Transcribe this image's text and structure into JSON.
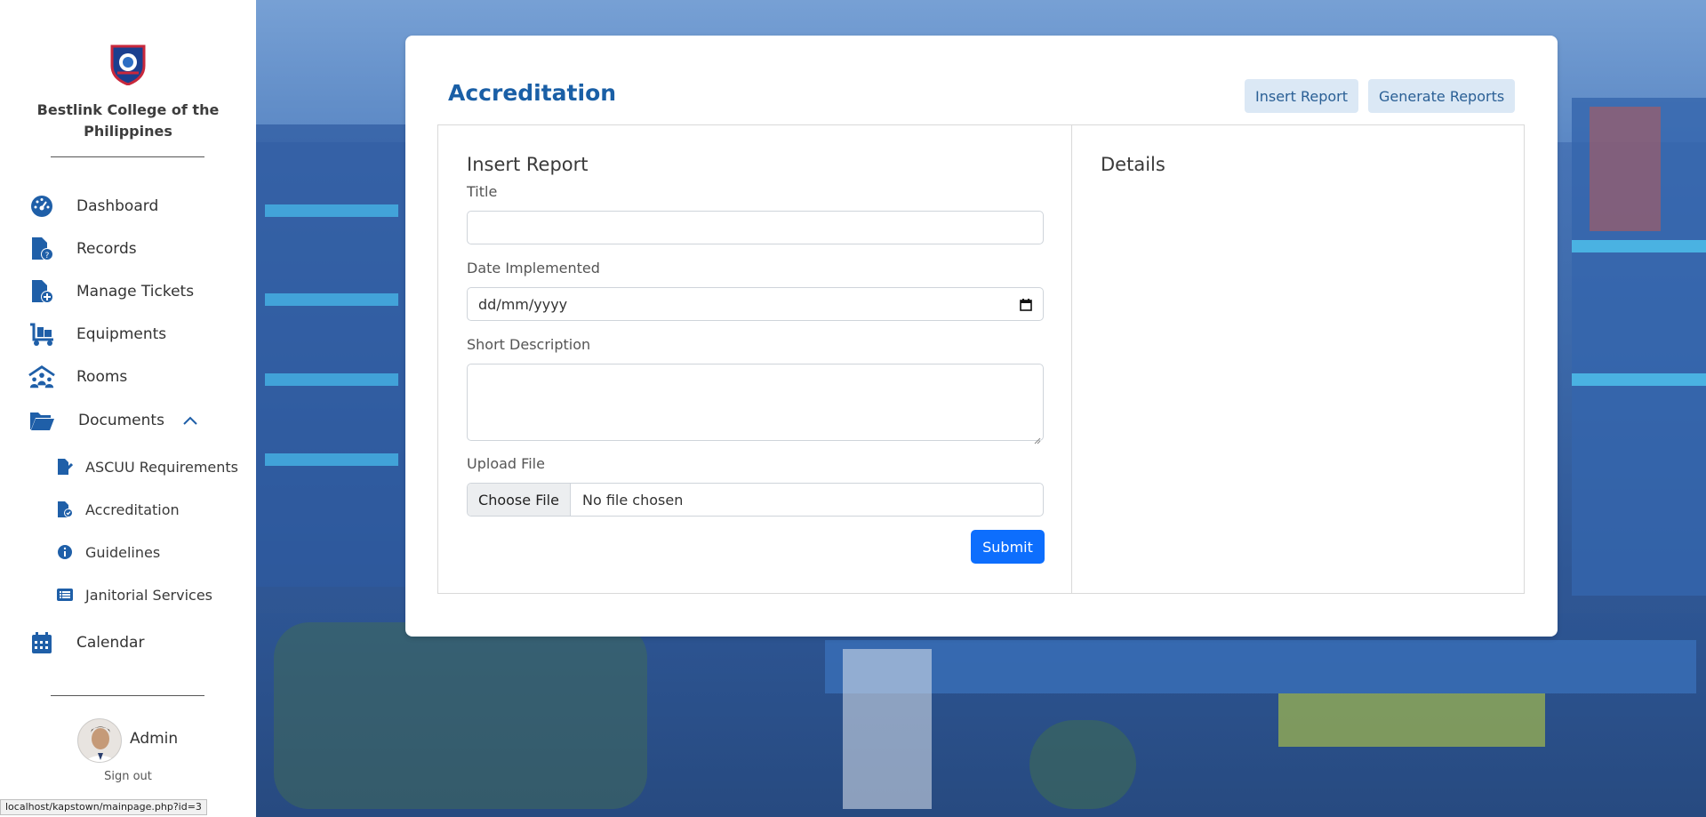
{
  "sidebar": {
    "college_name": "Bestlink College of the Philippines",
    "nav": [
      {
        "label": "Dashboard",
        "icon": "dashboard-gauge-icon"
      },
      {
        "label": "Records",
        "icon": "file-question-icon"
      },
      {
        "label": "Manage Tickets",
        "icon": "file-plus-icon"
      },
      {
        "label": "Equipments",
        "icon": "dolly-cart-icon"
      },
      {
        "label": "Rooms",
        "icon": "people-roof-icon"
      },
      {
        "label": "Documents",
        "icon": "folder-open-icon"
      }
    ],
    "documents_sub": [
      {
        "label": "ASCUU Requirements",
        "icon": "file-pen-icon"
      },
      {
        "label": "Accreditation",
        "icon": "file-check-icon"
      },
      {
        "label": "Guidelines",
        "icon": "info-circle-icon"
      },
      {
        "label": "Janitorial Services",
        "icon": "list-icon"
      }
    ],
    "calendar": {
      "label": "Calendar",
      "icon": "calendar-icon"
    },
    "user": {
      "name": "Admin",
      "signout": "Sign out"
    }
  },
  "status_url": "localhost/kapstown/mainpage.php?id=3",
  "main": {
    "title": "Accreditation",
    "buttons": {
      "insert": "Insert Report",
      "generate": "Generate Reports"
    },
    "form": {
      "heading": "Insert Report",
      "title_label": "Title",
      "title_value": "",
      "date_label": "Date Implemented",
      "date_placeholder": "dd/mm/yyyy",
      "desc_label": "Short Description",
      "desc_value": "",
      "upload_label": "Upload File",
      "choose_file": "Choose File",
      "file_status": "No file chosen",
      "submit": "Submit"
    },
    "details_heading": "Details"
  },
  "colors": {
    "accent": "#0d6efd",
    "title_blue": "#1a5fa6",
    "icon_blue": "#1f5fa8",
    "header_button_bg": "#dbe8f5"
  }
}
